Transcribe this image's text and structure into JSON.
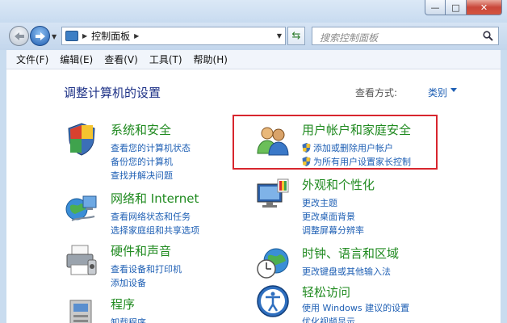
{
  "window": {
    "controls": {
      "minimize": "—",
      "maximize": "□",
      "close": "✕"
    }
  },
  "nav": {
    "breadcrumb": "控制面板",
    "search_placeholder": "搜索控制面板"
  },
  "menu": [
    "文件(F)",
    "编辑(E)",
    "查看(V)",
    "工具(T)",
    "帮助(H)"
  ],
  "main": {
    "title": "调整计算机的设置",
    "view_label": "查看方式:",
    "view_value": "类别"
  },
  "categories": {
    "security": {
      "title": "系统和安全",
      "links": [
        "查看您的计算机状态",
        "备份您的计算机",
        "查找并解决问题"
      ]
    },
    "network": {
      "title": "网络和 Internet",
      "links": [
        "查看网络状态和任务",
        "选择家庭组和共享选项"
      ]
    },
    "hardware": {
      "title": "硬件和声音",
      "links": [
        "查看设备和打印机",
        "添加设备"
      ]
    },
    "programs": {
      "title": "程序",
      "links": [
        "卸载程序"
      ]
    },
    "users": {
      "title": "用户帐户和家庭安全",
      "links": [
        "添加或删除用户帐户",
        "为所有用户设置家长控制"
      ]
    },
    "appearance": {
      "title": "外观和个性化",
      "links": [
        "更改主题",
        "更改桌面背景",
        "调整屏幕分辨率"
      ]
    },
    "clock": {
      "title": "时钟、语言和区域",
      "links": [
        "更改键盘或其他输入法"
      ]
    },
    "ease": {
      "title": "轻松访问",
      "links": [
        "使用 Windows 建议的设置",
        "优化视频显示"
      ]
    }
  },
  "colors": {
    "highlight_border": "#d8262e",
    "category_title": "#1f8a1f",
    "link": "#1e5fb4"
  }
}
